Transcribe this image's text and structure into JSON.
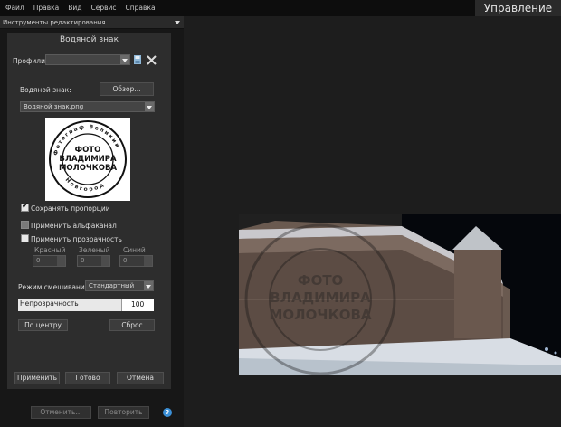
{
  "menu": [
    "Файл",
    "Правка",
    "Вид",
    "Сервис",
    "Справка"
  ],
  "mode_tab": "Управление",
  "panel": {
    "header": "Инструменты редактирования",
    "title": "Водяной знак",
    "profiles_label": "Профили",
    "profiles_value": "",
    "watermark_label": "Водяной знак:",
    "browse_label": "Обзор...",
    "watermark_file": "Водяной знак.png",
    "stamp": {
      "ring_top": "Фотограф Великий",
      "ring_bottom": "Новгород",
      "line1": "ФОТО",
      "line2": "ВЛАДИМИРА",
      "line3": "МОЛОЧКОВА"
    },
    "keep_proportions": {
      "label": "Сохранять пропорции",
      "checked": true
    },
    "apply_alpha": {
      "label": "Применить альфаканал",
      "checked": false
    },
    "apply_transparency": {
      "label": "Применить прозрачность",
      "checked": false
    },
    "color_labels": [
      "Красный",
      "Зеленый",
      "Синий"
    ],
    "color_values": [
      "0",
      "0",
      "0"
    ],
    "blend_label": "Режим смешивания:",
    "blend_value": "Стандартный",
    "opacity_label": "Непрозрачность",
    "opacity_value": "100",
    "opacity_fraction": 1.0,
    "center_label": "По центру",
    "reset_label": "Сброс",
    "apply_label": "Применить",
    "done_label": "Готово",
    "cancel_label": "Отмена"
  },
  "footer": {
    "undo_label": "Отменить...",
    "redo_label": "Повторить",
    "help_icon": "?"
  },
  "colors": {
    "accent_blue": "#3b8fd6",
    "panel_bg": "#2d2d2d",
    "canvas_bg": "#1d1d1d"
  }
}
